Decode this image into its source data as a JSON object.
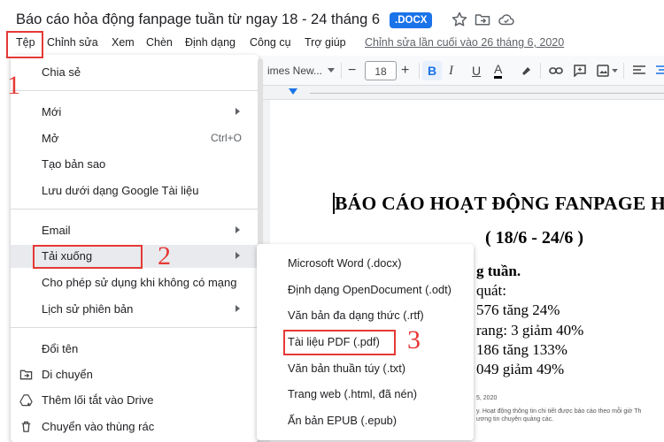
{
  "header": {
    "title": "Báo cáo hỏa động fanpage tuần từ ngay 18 - 24 tháng 6",
    "badge": ".DOCX"
  },
  "menu_bar": {
    "items": [
      "Tệp",
      "Chỉnh sửa",
      "Xem",
      "Chèn",
      "Định dạng",
      "Công cụ",
      "Trợ giúp"
    ],
    "last_edit": "Chỉnh sửa lần cuối vào 26 tháng 6, 2020"
  },
  "toolbar": {
    "font": "imes New...",
    "font_size": "18",
    "minus": "−",
    "plus": "+",
    "bold": "B",
    "italic": "I",
    "underline": "U",
    "text_color": "A"
  },
  "document": {
    "heading": "BÁO CÁO HOẠT ĐỘNG FANPAGE H",
    "subheading": "( 18/6 - 24/6 )",
    "lines": [
      "g tuần.",
      "quát:",
      "576 tăng 24%",
      "rang: 3 giảm 40%",
      "186 tăng 133%",
      "049 giảm 49%"
    ],
    "footnote_1": "5, 2020",
    "footnote_2": "y. Hoạt động thông tin chi tiết được báo cáo theo mỗi giờ Th",
    "footnote_3": "ương tin chuyên quảng các."
  },
  "file_menu": {
    "share": "Chia sẻ",
    "new": "Mới",
    "open": "Mở",
    "open_shortcut": "Ctrl+O",
    "make_copy": "Tạo bản sao",
    "save_as_google": "Lưu dưới dạng Google Tài liệu",
    "email": "Email",
    "download": "Tải xuống",
    "offline": "Cho phép sử dụng khi không có mạng",
    "version_history": "Lịch sử phiên bản",
    "rename": "Đổi tên",
    "move": "Di chuyển",
    "add_shortcut": "Thêm lối tắt vào Drive",
    "trash": "Chuyển vào thùng rác"
  },
  "download_menu": {
    "items": [
      "Microsoft Word (.docx)",
      "Định dạng OpenDocument (.odt)",
      "Văn bản đa dạng thức (.rtf)",
      "Tài liệu PDF (.pdf)",
      "Văn bản thuần túy (.txt)",
      "Trang web (.html, đã nén)",
      "Ấn bản EPUB (.epub)"
    ]
  },
  "annotations": [
    "1",
    "2",
    "3"
  ],
  "colors": {
    "accent": "#1a73e8",
    "annotation_red": "#e53935",
    "menu_hover": "#e8eaed"
  },
  "icons": {
    "star": "star-icon",
    "move_folder": "folder-move-icon",
    "cloud": "cloud-status-icon",
    "move": "folder-move-icon",
    "add_shortcut": "drive-shortcut-icon",
    "trash": "trash-icon",
    "submenu": "chevron-right-icon"
  }
}
